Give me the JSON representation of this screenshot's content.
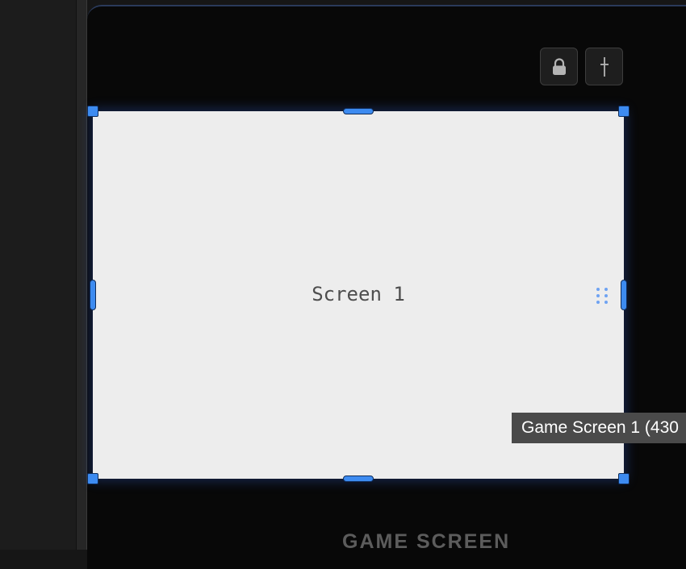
{
  "canvas": {
    "screen_label": "Screen 1",
    "tooltip": "Game Screen 1 (430",
    "section_label": "GAME SCREEN"
  },
  "toolbar": {
    "lock_icon": "lock-icon",
    "pin_icon": "pin-icon"
  },
  "colors": {
    "handle": "#3d8bf0",
    "screen_fill": "#ededed",
    "device_bg": "#080808"
  }
}
